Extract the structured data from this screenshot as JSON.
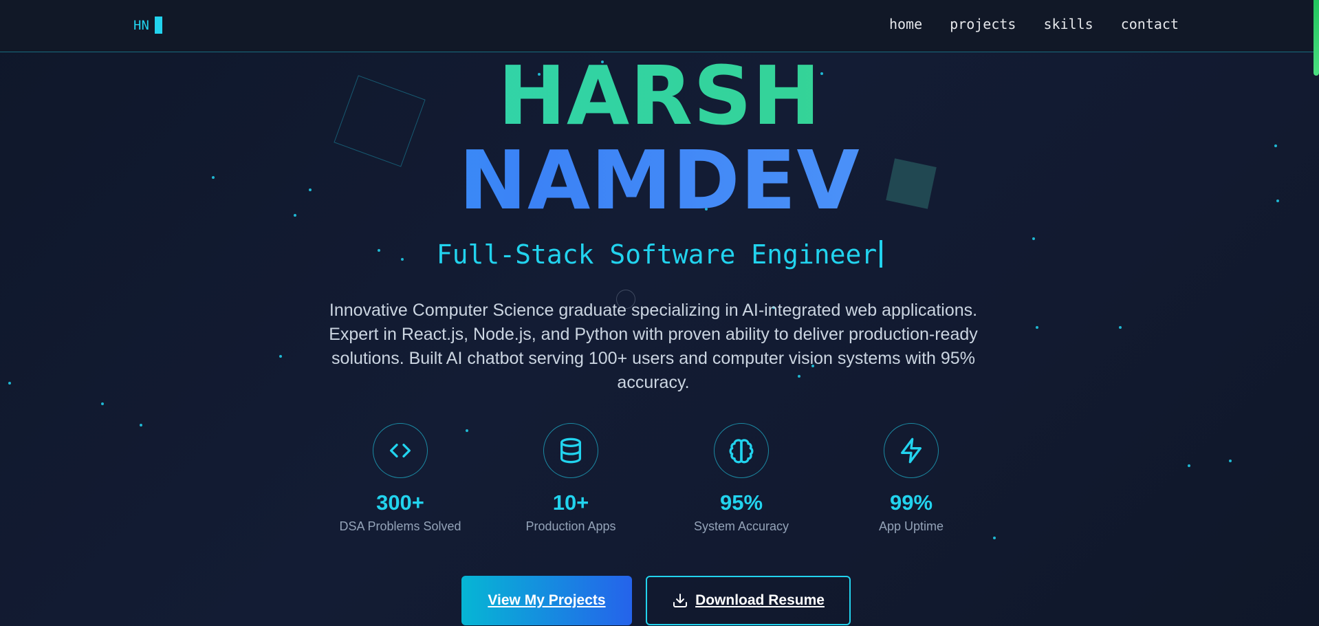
{
  "nav": {
    "logo_text": "HN",
    "links": [
      "home",
      "projects",
      "skills",
      "contact"
    ]
  },
  "hero": {
    "first_name": "HARSH",
    "last_name": "NAMDEV",
    "title": "Full-Stack Software Engineer",
    "intro": "Innovative Computer Science graduate specializing in AI-integrated web applications. Expert in React.js, Node.js, and Python with proven ability to deliver production-ready solutions. Built AI chatbot serving 100+ users and computer vision systems with 95% accuracy."
  },
  "stats": [
    {
      "icon": "code-icon",
      "value": "300+",
      "label": "DSA Problems Solved"
    },
    {
      "icon": "database-icon",
      "value": "10+",
      "label": "Production Apps"
    },
    {
      "icon": "brain-icon",
      "value": "95%",
      "label": "System Accuracy"
    },
    {
      "icon": "lightning-icon",
      "value": "99%",
      "label": "App Uptime"
    }
  ],
  "actions": {
    "primary_label": "View My Projects",
    "secondary_label": "Download Resume",
    "secondary_icon": "download-icon"
  },
  "colors": {
    "accent": "#22d3ee",
    "background": "#0f172a",
    "name_first_gradient": [
      "#2dd4bf",
      "#4ade80"
    ],
    "name_last_gradient": [
      "#38bdf8",
      "#60a5fa"
    ]
  }
}
